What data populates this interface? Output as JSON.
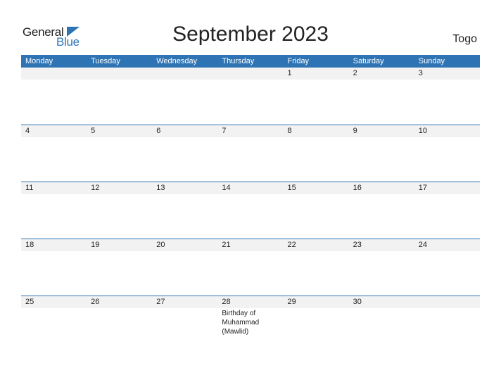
{
  "logo": {
    "line1": "General",
    "line2": "Blue",
    "accent_color": "#2e74b5"
  },
  "title": "September 2023",
  "country": "Togo",
  "weekdays": [
    "Monday",
    "Tuesday",
    "Wednesday",
    "Thursday",
    "Friday",
    "Saturday",
    "Sunday"
  ],
  "weeks": [
    {
      "days": [
        "",
        "",
        "",
        "",
        "1",
        "2",
        "3"
      ],
      "events": [
        "",
        "",
        "",
        "",
        "",
        "",
        ""
      ]
    },
    {
      "days": [
        "4",
        "5",
        "6",
        "7",
        "8",
        "9",
        "10"
      ],
      "events": [
        "",
        "",
        "",
        "",
        "",
        "",
        ""
      ]
    },
    {
      "days": [
        "11",
        "12",
        "13",
        "14",
        "15",
        "16",
        "17"
      ],
      "events": [
        "",
        "",
        "",
        "",
        "",
        "",
        ""
      ]
    },
    {
      "days": [
        "18",
        "19",
        "20",
        "21",
        "22",
        "23",
        "24"
      ],
      "events": [
        "",
        "",
        "",
        "",
        "",
        "",
        ""
      ]
    },
    {
      "days": [
        "25",
        "26",
        "27",
        "28",
        "29",
        "30",
        ""
      ],
      "events": [
        "",
        "",
        "",
        "Birthday of Muhammad (Mawlid)",
        "",
        "",
        ""
      ]
    }
  ]
}
